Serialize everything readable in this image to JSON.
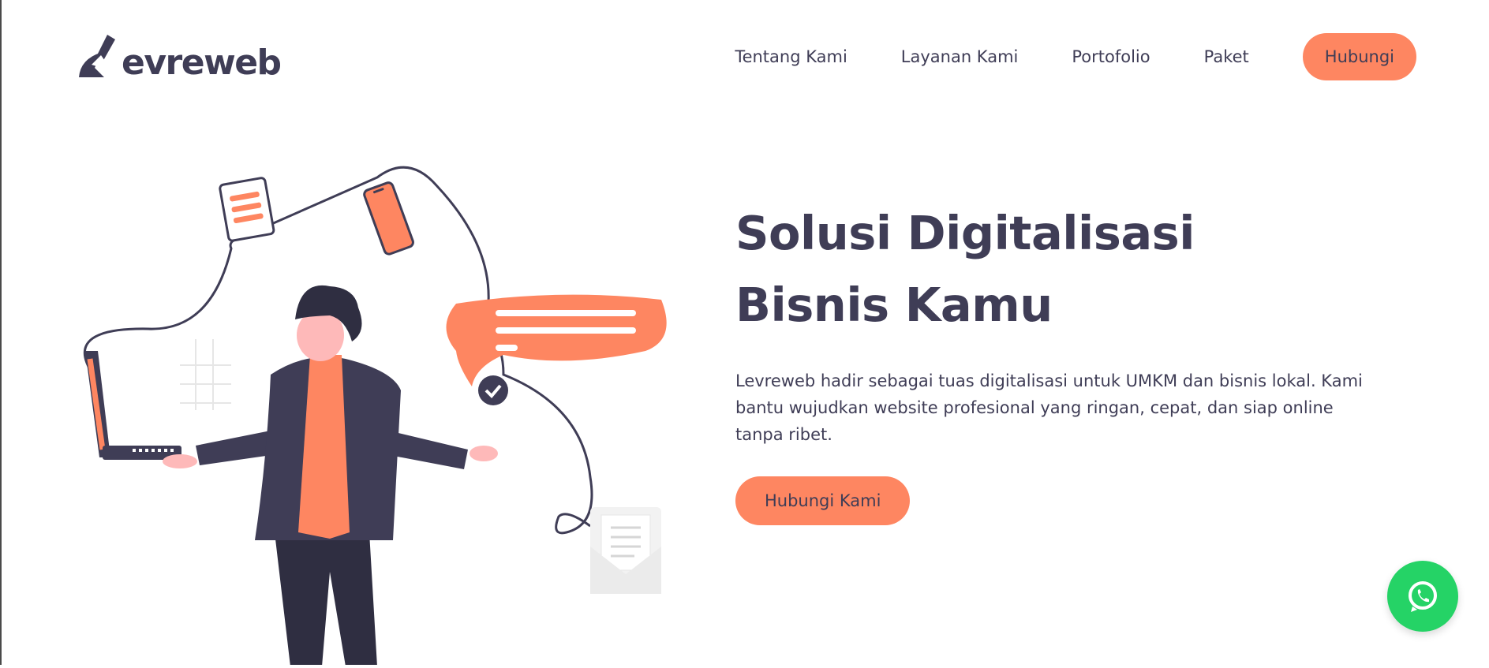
{
  "brand": {
    "logo_text": "evreweb"
  },
  "nav": {
    "links": [
      "Tentang Kami",
      "Layanan Kami",
      "Portofolio",
      "Paket"
    ],
    "cta_label": "Hubungi"
  },
  "hero": {
    "title_line1": "Solusi Digitalisasi",
    "title_line2": "Bisnis Kamu",
    "description": "Levreweb hadir sebagai tuas digitalisasi untuk UMKM dan bisnis lokal. Kami bantu wujudkan website profesional yang ringan, cepat, dan siap online tanpa ribet.",
    "cta_label": "Hubungi Kami"
  },
  "icons": {
    "whatsapp": "whatsapp-icon",
    "logo_mark": "lever-logo-icon"
  },
  "colors": {
    "accent": "#fe8661",
    "dark": "#3f3d56",
    "whatsapp": "#25d366",
    "background": "#ffffff"
  }
}
